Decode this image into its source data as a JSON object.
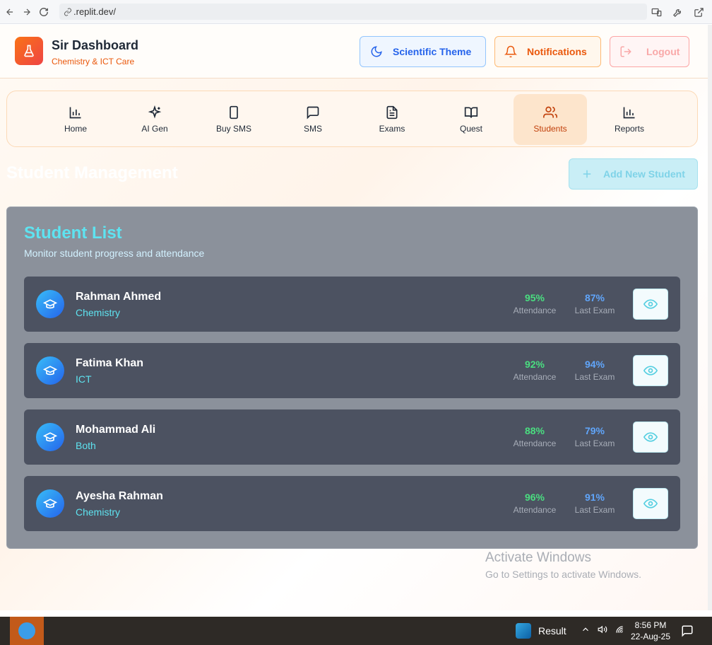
{
  "browser": {
    "url": ".replit.dev/"
  },
  "header": {
    "title": "Sir Dashboard",
    "subtitle": "Chemistry & ICT Care",
    "theme_button": "Scientific Theme",
    "notifications_button": "Notifications",
    "logout_button": "Logout"
  },
  "nav": {
    "items": [
      {
        "label": "Home",
        "icon": "bar-chart-icon"
      },
      {
        "label": "AI Gen",
        "icon": "sparkles-icon"
      },
      {
        "label": "Buy SMS",
        "icon": "smartphone-icon"
      },
      {
        "label": "SMS",
        "icon": "message-square-icon"
      },
      {
        "label": "Exams",
        "icon": "file-text-icon"
      },
      {
        "label": "Quest",
        "icon": "book-open-icon"
      },
      {
        "label": "Students",
        "icon": "users-icon",
        "active": true
      },
      {
        "label": "Reports",
        "icon": "bar-chart-icon"
      }
    ]
  },
  "page": {
    "title": "Student Management",
    "add_button": "Add New Student"
  },
  "student_list": {
    "title": "Student List",
    "subtitle": "Monitor student progress and attendance",
    "attendance_label": "Attendance",
    "exam_label": "Last Exam",
    "students": [
      {
        "name": "Rahman Ahmed",
        "subject": "Chemistry",
        "attendance": "95%",
        "last_exam": "87%"
      },
      {
        "name": "Fatima Khan",
        "subject": "ICT",
        "attendance": "92%",
        "last_exam": "94%"
      },
      {
        "name": "Mohammad Ali",
        "subject": "Both",
        "attendance": "88%",
        "last_exam": "79%"
      },
      {
        "name": "Ayesha Rahman",
        "subject": "Chemistry",
        "attendance": "96%",
        "last_exam": "91%"
      }
    ]
  },
  "watermark": {
    "line1": "Activate Windows",
    "line2": "Go to Settings to activate Windows."
  },
  "taskbar": {
    "app_label": "Result",
    "time": "8:56 PM",
    "date": "22-Aug-25"
  },
  "colors": {
    "brand_orange": "#f97316",
    "active_nav_bg": "#fde5cc",
    "panel_bg": "#8b919b",
    "row_bg": "#4c5261",
    "accent_cyan": "#5ee3f0",
    "attendance_green": "#4ade80",
    "exam_blue": "#60a5fa"
  }
}
